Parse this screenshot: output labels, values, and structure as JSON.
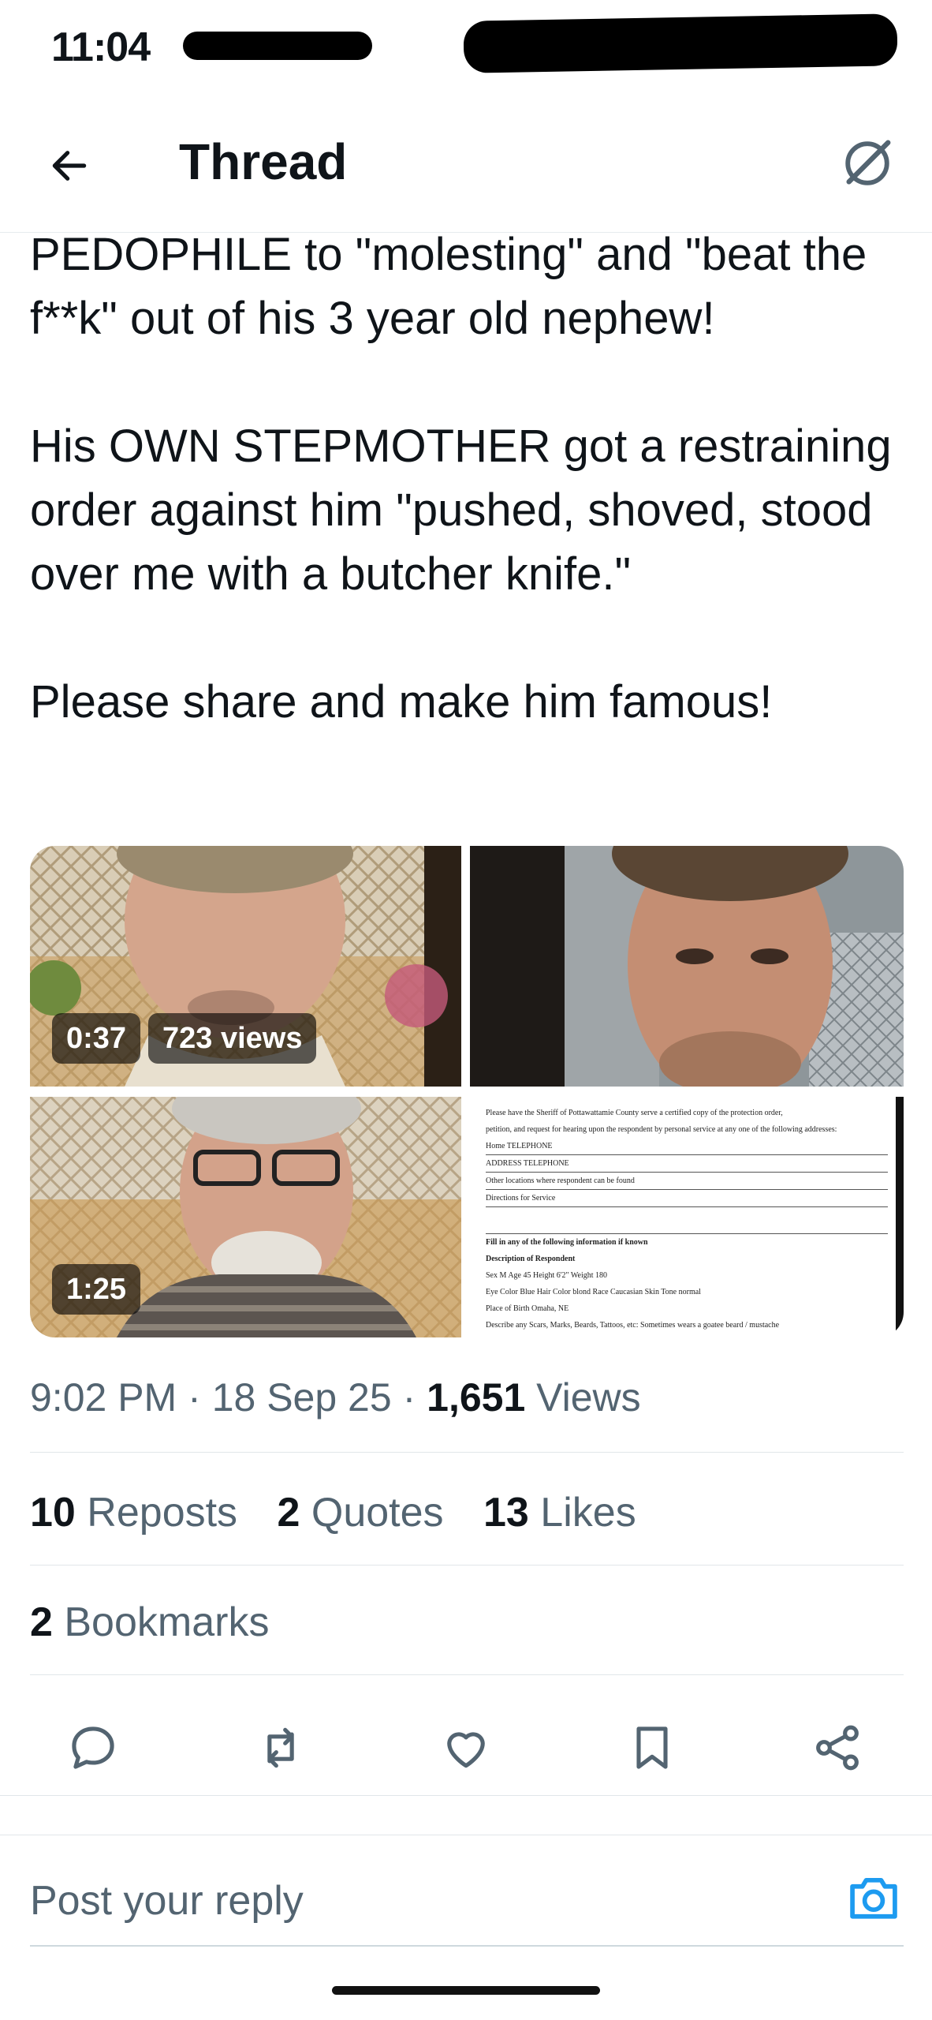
{
  "status_bar": {
    "time": "11:04"
  },
  "header": {
    "title": "Thread",
    "back_icon": "arrow-left-icon",
    "grok_icon": "grok-icon"
  },
  "tweet": {
    "text": "PEDOPHILE to \"molesting\" and \"beat the f**k\" out of his 3 year old nephew!\n\nHis OWN STEPMOTHER got a restraining order against him \"pushed, shoved, stood over me with a butcher knife.\"\n\nPlease share and make him famous!",
    "media": [
      {
        "duration": "0:37",
        "views": "723 views"
      },
      {
        "duration": ""
      },
      {
        "duration": "1:25"
      },
      {
        "document_lines": [
          "Please have the Sheriff of Pottawattamie County serve a certified copy of the protection order,",
          "petition, and request for hearing upon the respondent by personal service at any one of the following addresses:",
          "Home TELEPHONE",
          "ADDRESS TELEPHONE",
          "Other locations where respondent can be found",
          "Directions for Service",
          "Fill in any of the following information if known",
          "Description of Respondent",
          "Sex M Age 45 Height 6'2\" Weight 180",
          "Eye Color Blue Hair Color blond Race Caucasian Skin Tone normal",
          "Place of Birth Omaha, NE",
          "Describe any Scars, Marks, Beards, Tattoos, etc: Sometimes wears a goatee beard / mustache"
        ]
      }
    ],
    "meta": {
      "time": "9:02 PM",
      "sep1": "·",
      "date": "18 Sep 25",
      "sep2": "·",
      "views_count": "1,651",
      "views_label": "Views"
    }
  },
  "stats": {
    "reposts_count": "10",
    "reposts_label": "Reposts",
    "quotes_count": "2",
    "quotes_label": "Quotes",
    "likes_count": "13",
    "likes_label": "Likes",
    "bookmarks_count": "2",
    "bookmarks_label": "Bookmarks"
  },
  "actions": [
    "reply-icon",
    "repost-icon",
    "like-icon",
    "bookmark-icon",
    "share-icon"
  ],
  "reply": {
    "placeholder": "Post your reply",
    "camera_icon": "camera-icon"
  },
  "colors": {
    "text": "#0f1419",
    "secondary": "#536471",
    "accent": "#1d9bf0",
    "divider": "#e1e6e9"
  }
}
